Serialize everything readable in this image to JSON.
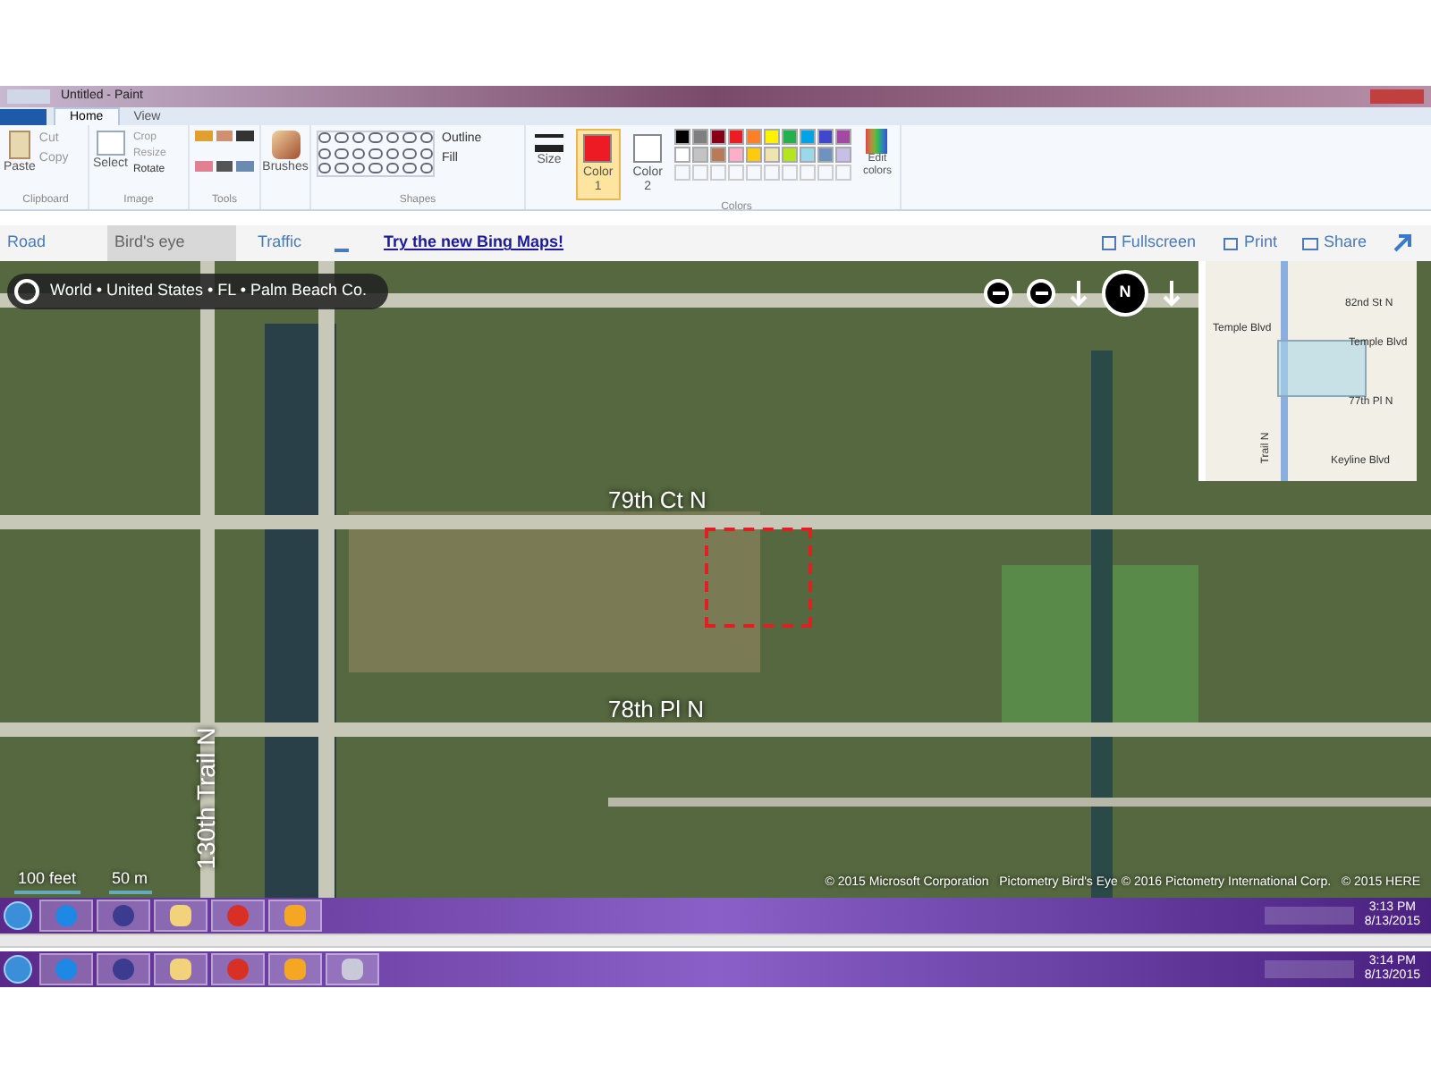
{
  "window": {
    "title": "Untitled - Paint"
  },
  "ribbon_tabs": [
    {
      "label": "Home",
      "selected": true
    },
    {
      "label": "View",
      "selected": false
    }
  ],
  "ribbon": {
    "clipboard": {
      "paste": "Paste",
      "cut": "Cut",
      "copy": "Copy",
      "label": "Clipboard"
    },
    "image": {
      "select": "Select",
      "crop": "Crop",
      "resize": "Resize",
      "rotate": "Rotate",
      "label": "Image"
    },
    "tools": {
      "label": "Tools"
    },
    "brushes": "Brushes",
    "shapes": {
      "outline": "Outline",
      "fill": "Fill",
      "label": "Shapes"
    },
    "size": "Size",
    "color1": {
      "label": "Color",
      "number": "1",
      "color": "#ed1c24",
      "selected": true
    },
    "color2": {
      "label": "Color",
      "number": "2",
      "color": "#ffffff",
      "selected": false
    },
    "palette": [
      {
        "color": "#000000"
      },
      {
        "color": "#7f7f7f"
      },
      {
        "color": "#880015"
      },
      {
        "color": "#ed1c24"
      },
      {
        "color": "#ff7f27"
      },
      {
        "color": "#fff200"
      },
      {
        "color": "#22b14c"
      },
      {
        "color": "#00a2e8"
      },
      {
        "color": "#3f48cc"
      },
      {
        "color": "#a349a4"
      },
      {
        "color": "#ffffff"
      },
      {
        "color": "#c3c3c3"
      },
      {
        "color": "#b97a57"
      },
      {
        "color": "#ffaec9"
      },
      {
        "color": "#ffc90e"
      },
      {
        "color": "#efe4b0"
      },
      {
        "color": "#b5e61d"
      },
      {
        "color": "#99d9ea"
      },
      {
        "color": "#7092be"
      },
      {
        "color": "#c8bfe7"
      }
    ],
    "colors_label": "Colors",
    "edit_colors": "Edit colors"
  },
  "map_toolbar": {
    "views": [
      {
        "label": "Road",
        "selected": false
      },
      {
        "label": "Bird's eye",
        "selected": true
      }
    ],
    "traffic": "Traffic",
    "promo_link": "Try the new Bing Maps!",
    "fullscreen": "Fullscreen",
    "print": "Print",
    "share": "Share"
  },
  "map": {
    "breadcrumb": "World • United States • FL • Palm Beach Co.",
    "compass": "N",
    "street_labels": [
      {
        "text": "79th Ct N",
        "kind": "horizontal"
      },
      {
        "text": "78th Pl N",
        "kind": "horizontal"
      },
      {
        "text": "130th Trail N",
        "kind": "vertical"
      }
    ],
    "minimap_labels": [
      {
        "text": "82nd St N"
      },
      {
        "text": "Temple Blvd"
      },
      {
        "text": "Temple Blvd"
      },
      {
        "text": "77th Pl N"
      },
      {
        "text": "Keyline Blvd"
      }
    ],
    "minimap_vertical_label": "Trail N",
    "scale": [
      "100 feet",
      "50 m"
    ],
    "copyright": "© 2015 Microsoft Corporation   Pictometry Bird's Eye © 2016 Pictometry International Corp.   © 2015 HERE"
  },
  "taskbars": [
    {
      "apps": [
        {
          "kind": "browser"
        },
        {
          "kind": "lock"
        },
        {
          "kind": "folder"
        },
        {
          "kind": "chrome"
        },
        {
          "kind": "mail"
        }
      ],
      "time": "3:13 PM",
      "date": "8/13/2015"
    },
    {
      "apps": [
        {
          "kind": "browser"
        },
        {
          "kind": "lock"
        },
        {
          "kind": "folder"
        },
        {
          "kind": "chrome"
        },
        {
          "kind": "mail"
        },
        {
          "kind": "paint"
        }
      ],
      "time": "3:14 PM",
      "date": "8/13/2015"
    }
  ]
}
